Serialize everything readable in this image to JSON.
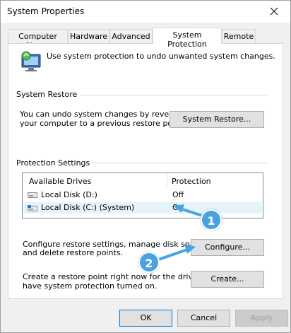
{
  "window": {
    "title": "System Properties"
  },
  "tabs": [
    {
      "label": "Computer Name"
    },
    {
      "label": "Hardware"
    },
    {
      "label": "Advanced"
    },
    {
      "label": "System Protection",
      "active": true
    },
    {
      "label": "Remote"
    }
  ],
  "intro": {
    "text": "Use system protection to undo unwanted system changes."
  },
  "system_restore": {
    "title": "System Restore",
    "description_line1": "You can undo system changes by reverting",
    "description_line2": "your computer to a previous restore point.",
    "button": "System Restore..."
  },
  "protection_settings": {
    "title": "Protection Settings",
    "columns": [
      "Available Drives",
      "Protection"
    ],
    "drives": [
      {
        "name": "Local Disk (D:)",
        "protection": "Off",
        "selected": false
      },
      {
        "name": "Local Disk (C:) (System)",
        "protection": "O",
        "selected": true
      }
    ]
  },
  "configure": {
    "text_line1": "Configure restore settings, manage disk space,",
    "text_line2": "and delete restore points.",
    "button": "Configure..."
  },
  "create": {
    "text_line1": "Create a restore point right now for the drives that",
    "text_line2": "have system protection turned on.",
    "button": "Create..."
  },
  "footer": {
    "ok": "OK",
    "cancel": "Cancel",
    "apply": "Apply"
  },
  "annotations": [
    {
      "label": "1"
    },
    {
      "label": "2"
    }
  ],
  "colors": {
    "badge": "#4aa3df",
    "selection": "#e5f3fb",
    "window_bg": "#f0f0f0"
  }
}
